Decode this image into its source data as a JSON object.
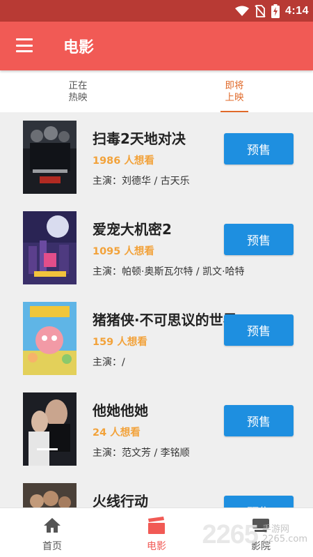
{
  "status_bar": {
    "time": "4:14"
  },
  "app_bar": {
    "title": "电影"
  },
  "tabs": [
    {
      "label": "正在\n热映",
      "active": false
    },
    {
      "label": "即将\n上映",
      "active": true
    }
  ],
  "movies": [
    {
      "title": "扫毒2天地对决",
      "want": "1986 人想看",
      "cast": "主演：刘德华 / 古天乐",
      "button": "预售"
    },
    {
      "title": "爱宠大机密2",
      "want": "1095 人想看",
      "cast": "主演：帕顿·奥斯瓦尔特 / 凯文·哈特",
      "button": "预售"
    },
    {
      "title": "猪猪侠·不可思议的世界",
      "want": "159 人想看",
      "cast": "主演：/",
      "button": "预售"
    },
    {
      "title": "他她他她",
      "want": "24 人想看",
      "cast": "主演：范文芳 / 李铭顺",
      "button": "预售"
    },
    {
      "title": "火线行动",
      "want": "",
      "cast": "",
      "button": "预售"
    }
  ],
  "bottom_nav": [
    {
      "label": "首页",
      "icon": "home-icon",
      "active": false
    },
    {
      "label": "电影",
      "icon": "clapperboard-icon",
      "active": true
    },
    {
      "label": "影院",
      "icon": "cinema-icon",
      "active": false
    }
  ],
  "watermark": {
    "number": "2265",
    "site": "手游网",
    "url": "2265.com"
  },
  "colors": {
    "app_bar": "#f15a55",
    "status_bar": "#b83a34",
    "accent_tab": "#e06a2a",
    "button": "#1e8fe0",
    "want": "#f2a23a"
  }
}
